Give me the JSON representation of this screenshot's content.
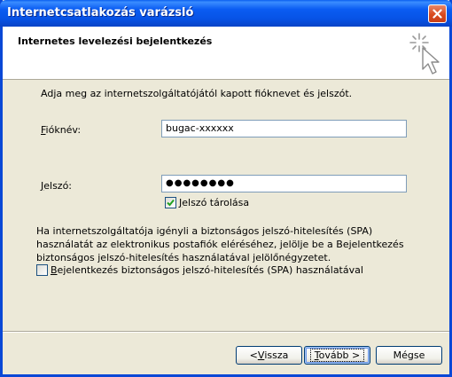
{
  "window": {
    "title": "Internetcsatlakozás varázsló",
    "close_icon": "close-icon"
  },
  "header": {
    "title": "Internetes levelezési bejelentkezés",
    "icon": "wizard-cursor-icon"
  },
  "form": {
    "instruction": "Adja meg az internetszolgáltatójától kapott fióknevet és jelszót.",
    "account_label_accel": "F",
    "account_label_rest": "ióknév:",
    "account_value": "bugac-xxxxxx",
    "password_label_accel": "J",
    "password_label_rest": "elszó:",
    "password_value": "●●●●●●●●",
    "remember_checked": true,
    "remember_label_accel": "J",
    "remember_label_rest": "elszó tárolása",
    "spa_info": "Ha internetszolgáltatója igényli a biztonságos jelszó-hitelesítés (SPA) használatát az elektronikus postafiók eléréséhez, jelölje be a Bejelentkezés biztonságos jelszó-hitelesítés használatával jelölőnégyzetet.",
    "spa_checked": false,
    "spa_label_accel": "B",
    "spa_label_rest": "ejelentkezés biztonságos jelszó-hitelesítés (SPA) használatával"
  },
  "buttons": {
    "back_prefix": "< ",
    "back_accel": "V",
    "back_rest": "issza",
    "next_accel": "T",
    "next_rest": "ovább >",
    "cancel": "Mégse"
  },
  "colors": {
    "titlebar": "#0a5cf2",
    "dialog_bg": "#ece9d8",
    "checkmark": "#21a121"
  }
}
